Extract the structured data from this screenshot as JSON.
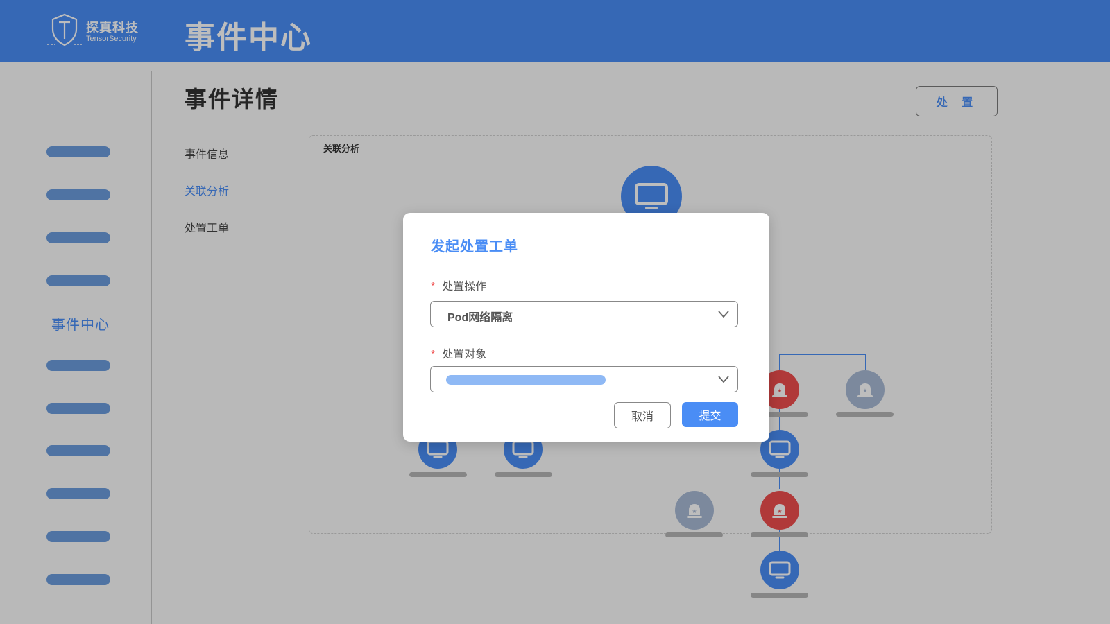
{
  "header": {
    "logo_cn": "探真科技",
    "logo_en": "TensorSecurity",
    "title": "事件中心"
  },
  "sidebar": {
    "active_label": "事件中心",
    "placeholder_items": 10
  },
  "main": {
    "page_title": "事件详情",
    "action_button": "处 置",
    "tabs": [
      {
        "label": "事件信息",
        "active": false
      },
      {
        "label": "关联分析",
        "active": true
      },
      {
        "label": "处置工单",
        "active": false
      }
    ],
    "panel_title": "关联分析"
  },
  "graph": {
    "node_icons": [
      "monitor-icon",
      "alarm-icon"
    ]
  },
  "modal": {
    "title": "发起处置工单",
    "field1": {
      "required_mark": "*",
      "label": "处置操作",
      "value": "Pod网络隔离"
    },
    "field2": {
      "required_mark": "*",
      "label": "处置对象",
      "value": ""
    },
    "cancel": "取消",
    "submit": "提交"
  },
  "colors": {
    "brand": "#4a8df5",
    "alert": "#ee4d4d",
    "muted_node": "#a8b9d4",
    "required": "#ee3b3b"
  }
}
